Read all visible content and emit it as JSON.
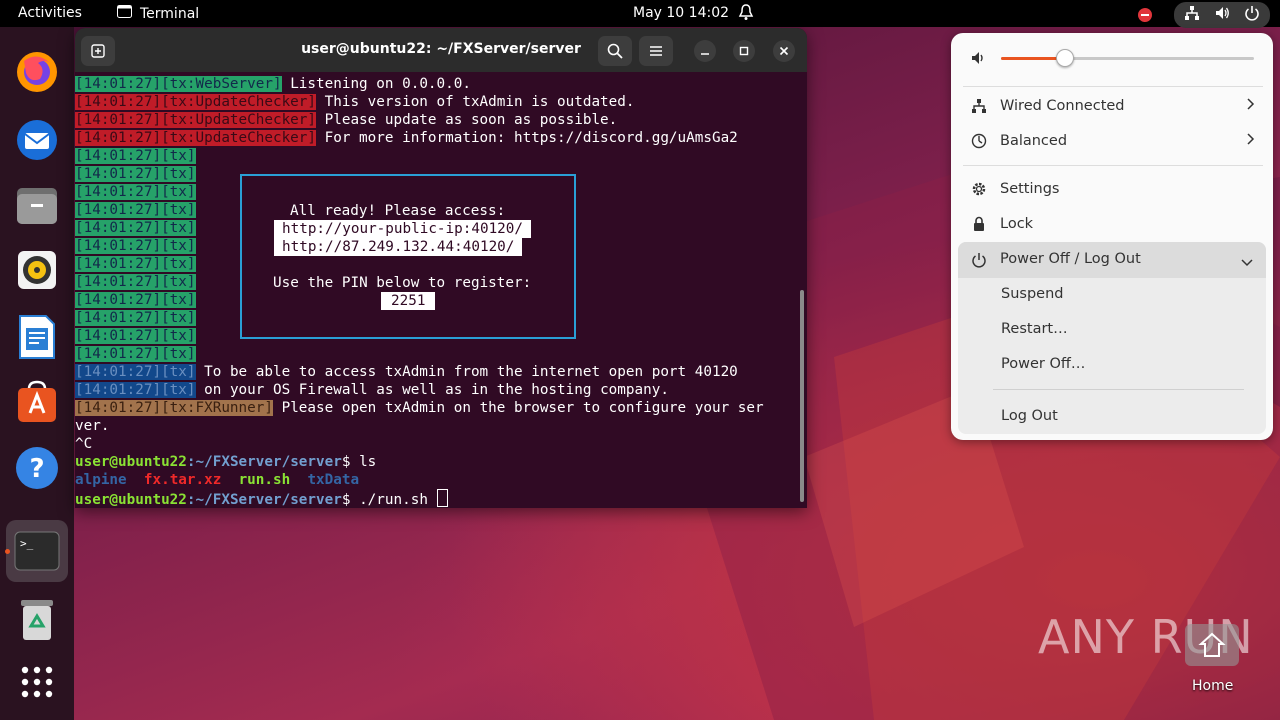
{
  "topbar": {
    "activities": "Activities",
    "app_name": "Terminal",
    "date": "May 10",
    "time": "14:02"
  },
  "terminal": {
    "title": "user@ubuntu22: ~/FXServer/server",
    "lines": [
      {
        "tag": "[14:01:27][tx:WebServer]",
        "text": " Listening on 0.0.0.0."
      },
      {
        "tag": "[14:01:27][tx:UpdateChecker]",
        "text": " This version of txAdmin is outdated."
      },
      {
        "tag": "[14:01:27][tx:UpdateChecker]",
        "text": " Please update as soon as possible."
      },
      {
        "tag": "[14:01:27][tx:UpdateChecker]",
        "text": " For more information: https://discord.gg/uAmsGa2"
      },
      {
        "tag": "[14:01:27][tx]"
      },
      {
        "tag": "[14:01:27][tx]"
      },
      {
        "tag": "[14:01:27][tx]"
      },
      {
        "tag": "[14:01:27][tx]"
      },
      {
        "tag": "[14:01:27][tx]"
      },
      {
        "tag": "[14:01:27][tx]"
      },
      {
        "tag": "[14:01:27][tx]"
      },
      {
        "tag": "[14:01:27][tx]"
      },
      {
        "tag": "[14:01:27][tx]"
      },
      {
        "tag": "[14:01:27][tx]"
      },
      {
        "tag": "[14:01:27][tx]"
      },
      {
        "tag": "[14:01:27][tx]"
      },
      {
        "tag": "[14:01:27][tx]",
        "text": " To be able to access txAdmin from the internet open port 40120"
      },
      {
        "tag": "[14:01:27][tx]",
        "text": " on your OS Firewall as well as in the hosting company."
      },
      {
        "tag": "[14:01:27][tx:FXRunner]",
        "text": " Please open txAdmin on the browser to configure your ser"
      }
    ],
    "wrap_line": "ver.",
    "ctrl_c": "^C",
    "prompt_user": "user@ubuntu22",
    "prompt_path": ":~/FXServer/server",
    "prompt_sign": "$ ",
    "cmd1": "ls",
    "ls_output": {
      "alpine": "alpine",
      "fx": "fx.tar.xz",
      "run": "run.sh",
      "txdata": "txData"
    },
    "cmd2": "./run.sh ",
    "box": {
      "ready": "All ready! Please access:",
      "url1": "http://your-public-ip:40120/",
      "url2": "http://87.249.132.44:40120/",
      "pin_label": "Use the PIN below to register:",
      "pin": "2251"
    }
  },
  "system_menu": {
    "volume_level": 0.25,
    "wired": "Wired Connected",
    "power_mode": "Balanced",
    "settings": "Settings",
    "lock": "Lock",
    "power_off_logout": "Power Off / Log Out",
    "suspend": "Suspend",
    "restart": "Restart…",
    "power_off": "Power Off…",
    "log_out": "Log Out"
  },
  "watermark": {
    "text": "ANY RUN",
    "home_label": "Home"
  },
  "colors": {
    "accent": "#e95420",
    "terminal_bg": "#300a24"
  }
}
